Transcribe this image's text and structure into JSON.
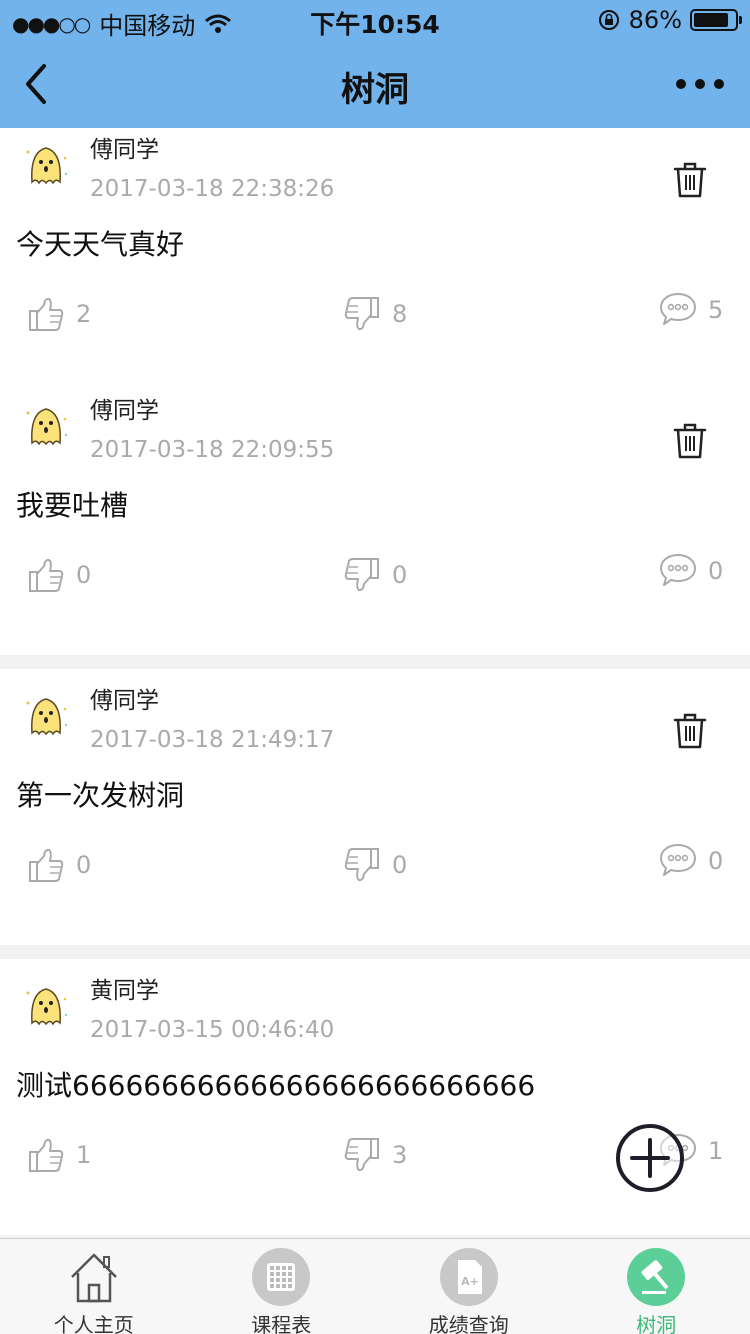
{
  "status_bar": {
    "signal": "●●●○○",
    "carrier": "中国移动",
    "time": "下午10:54",
    "battery": "86%",
    "battery_level": 0.86
  },
  "nav": {
    "title": "树洞"
  },
  "posts": [
    {
      "author": "傅同学",
      "time": "2017-03-18 22:38:26",
      "content": "今天天气真好",
      "likes": "2",
      "dislikes": "8",
      "comments": "5"
    },
    {
      "author": "傅同学",
      "time": "2017-03-18 22:09:55",
      "content": "我要吐槽",
      "likes": "0",
      "dislikes": "0",
      "comments": "0"
    },
    {
      "author": "傅同学",
      "time": "2017-03-18 21:49:17",
      "content": "第一次发树洞",
      "likes": "0",
      "dislikes": "0",
      "comments": "0"
    },
    {
      "author": "黄同学",
      "time": "2017-03-15 00:46:40",
      "content": "测试66666666666666666666666666",
      "likes": "1",
      "dislikes": "3",
      "comments": "1"
    }
  ],
  "tabs": [
    {
      "label": "个人主页",
      "icon": "home-icon"
    },
    {
      "label": "课程表",
      "icon": "grid-icon"
    },
    {
      "label": "成绩查询",
      "icon": "grade-doc-icon"
    },
    {
      "label": "树洞",
      "icon": "gavel-icon"
    }
  ],
  "colors": {
    "nav_bg": "#72b3ec",
    "tab_active": "#3cb879",
    "muted": "#aaaaaa"
  }
}
